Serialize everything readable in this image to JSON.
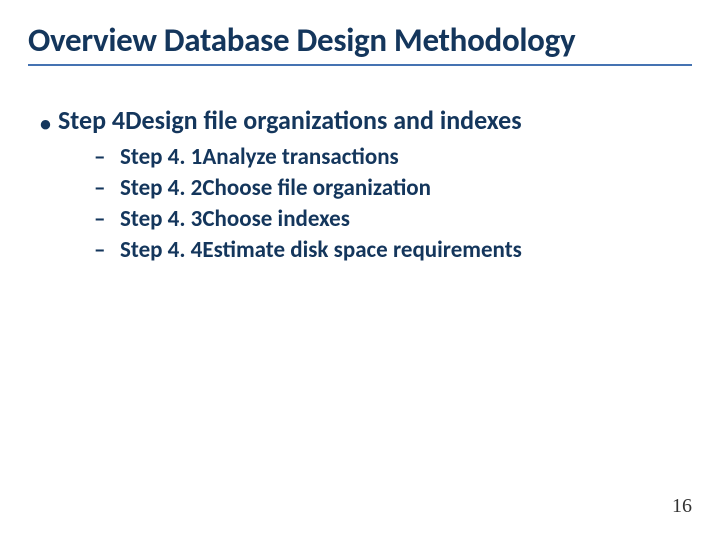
{
  "title": "Overview Database Design Methodology",
  "step": {
    "label": "Step 4",
    "text": "Design file organizations and indexes"
  },
  "substeps": [
    {
      "label": "Step 4. 1",
      "text": "Analyze transactions"
    },
    {
      "label": "Step 4. 2",
      "text": "Choose file organization"
    },
    {
      "label": "Step 4. 3",
      "text": "Choose indexes"
    },
    {
      "label": "Step 4. 4",
      "text": "Estimate disk space requirements"
    }
  ],
  "pageNumber": "16"
}
